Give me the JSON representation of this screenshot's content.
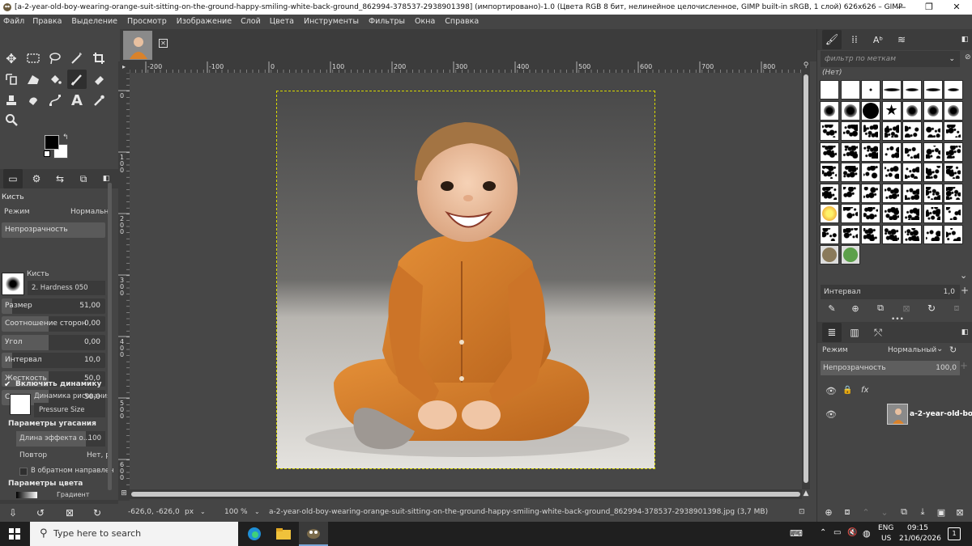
{
  "window": {
    "title": "[a-2-year-old-boy-wearing-orange-suit-sitting-on-the-ground-happy-smiling-white-back-ground_862994-378537-2938901398] (импортировано)-1.0 (Цвета RGB 8 бит, нелинейное целочисленное, GIMP built-in sRGB, 1 слой) 626x626 – GIMP",
    "minimize": "—",
    "maximize": "❐",
    "close": "✕"
  },
  "menu": [
    "Файл",
    "Правка",
    "Выделение",
    "Просмотр",
    "Изображение",
    "Слой",
    "Цвета",
    "Инструменты",
    "Фильтры",
    "Окна",
    "Справка"
  ],
  "tool_options": {
    "tool_name": "Кисть",
    "mode_label": "Режим",
    "mode_value": "Нормальн",
    "opacity_label": "Непрозрачность",
    "brush_label": "Кисть",
    "brush_value": "2. Hardness 050",
    "sliders": [
      {
        "label": "Размер",
        "value": "51,00",
        "fill": 0.1
      },
      {
        "label": "Соотношение сторон",
        "value": "0,00",
        "fill": 0.45
      },
      {
        "label": "Угол",
        "value": "0,00",
        "fill": 0.45
      },
      {
        "label": "Интервал",
        "value": "10,0",
        "fill": 0.1
      },
      {
        "label": "Жесткость",
        "value": "50,0",
        "fill": 0.45
      },
      {
        "label": "Сила",
        "value": "50,0",
        "fill": 0.45
      }
    ],
    "dynamics_checkbox": "Включить динамику",
    "dynamics_label": "Динамика рисования",
    "dynamics_value": "Pressure Size",
    "fade_section": "Параметры угасания",
    "fade_length_label": "Длина эффекта о...",
    "fade_length_value": "100",
    "repeat_label": "Повтор",
    "repeat_value": "Нет, р",
    "reverse_label": "В обратном направлен",
    "color_section": "Параметры цвета",
    "gradient_label": "Градиент"
  },
  "rulers": {
    "h_ticks": [
      "-200",
      "-100",
      "0",
      "100",
      "200",
      "300",
      "400",
      "500",
      "600",
      "700",
      "800"
    ],
    "v_ticks": [
      "0",
      "100",
      "200",
      "300",
      "400",
      "500",
      "600"
    ]
  },
  "status": {
    "coords": "-626,0, -626,0",
    "unit": "px",
    "zoom": "100 %",
    "file": "a-2-year-old-boy-wearing-orange-suit-sitting-on-the-ground-happy-smiling-white-back-ground_862994-378537-2938901398.jpg (3,7 MB)"
  },
  "brushes_panel": {
    "filter_placeholder": "фильтр по меткам",
    "tag": "(Нет)",
    "interval_label": "Интервал",
    "interval_value": "1,0"
  },
  "layers_panel": {
    "mode_label": "Режим",
    "mode_value": "Нормальный",
    "opacity_label": "Непрозрачность",
    "opacity_value": "100,0",
    "layer_name": "a-2-year-old-boy-wearing"
  },
  "taskbar": {
    "search_placeholder": "Type here to search",
    "lang_top": "ENG",
    "lang_bottom": "US",
    "time": "09:15",
    "date": "21/06/2026",
    "notif_count": "1"
  },
  "colors": {
    "accent_yellow": "#d8d800",
    "panel_bg": "#454545",
    "orange_suit": "#d9822b"
  }
}
